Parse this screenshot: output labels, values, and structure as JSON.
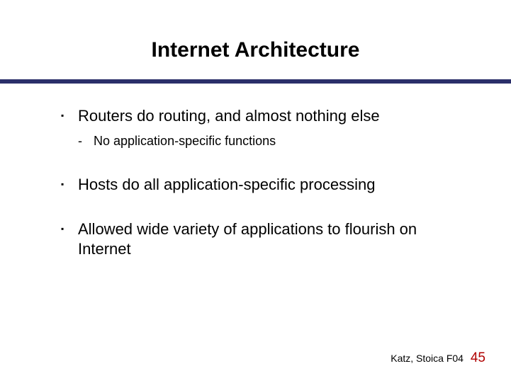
{
  "title": "Internet Architecture",
  "bullets": [
    {
      "text": "Routers do routing, and almost nothing else",
      "sub": [
        "No application-specific functions"
      ]
    },
    {
      "text": "Hosts do all application-specific processing",
      "sub": []
    },
    {
      "text": "Allowed wide variety of applications to flourish on Internet",
      "sub": []
    }
  ],
  "footer": {
    "attrib": "Katz, Stoica F04",
    "page": "45"
  }
}
